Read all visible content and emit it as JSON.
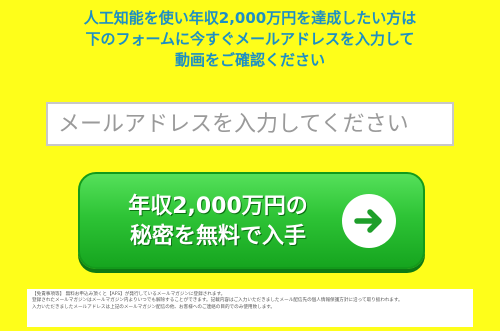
{
  "headline": {
    "line1": "人工知能を使い年収2,000万円を達成したい方は",
    "line2": "下のフォームに今すぐメールアドレスを入力して",
    "line3": "動画をご確認ください"
  },
  "email_field": {
    "placeholder": "メールアドレスを入力してください",
    "value": ""
  },
  "cta_button": {
    "line1": "年収2,000万円の",
    "line2": "秘密を無料で入手",
    "icon": "arrow-right-icon"
  },
  "disclaimer": {
    "line1": "【免責事項等】 無料お申込み頂くと【AFS】が発行しているメールマガジンに登録されます。",
    "line2": "登録されたメールマガジンはメールマガジン内よりいつでも解除することができます。記載内容はご入力いただきましたメール配信先の個人情報保護方針に沿って取り扱われます。",
    "line3": "入力いただきましたメールアドレスは上記のメールマガジン配信の他、お客様へのご連絡の目的でのみ使用致します。"
  },
  "colors": {
    "background": "#fefe1a",
    "headline_text": "#1d8fc4",
    "cta_green": "#2ec436",
    "arrow_green": "#1e9e2a"
  }
}
